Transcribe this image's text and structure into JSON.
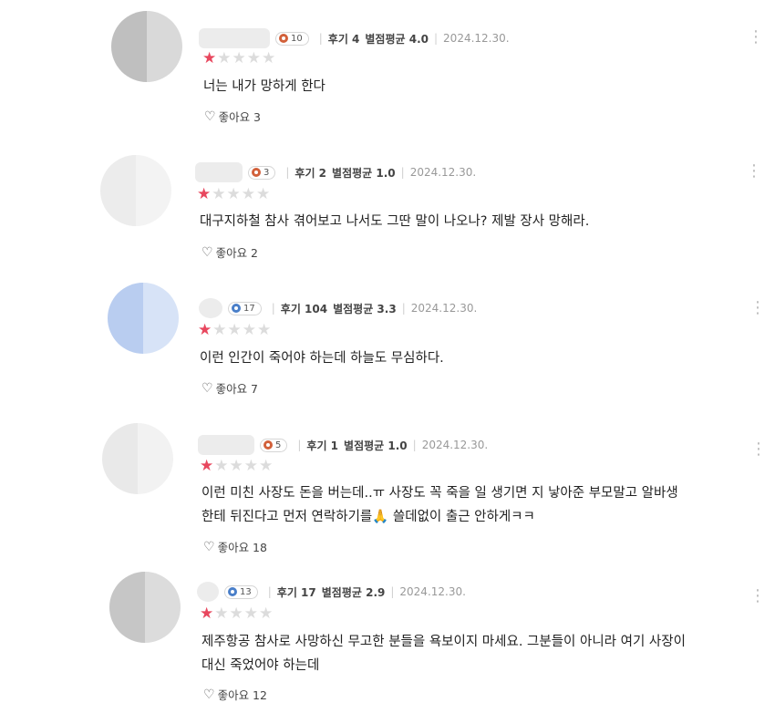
{
  "review_list": [
    {
      "avatar_colors": [
        "#bfbfbf",
        "#d9d9d9"
      ],
      "badge_count": "10",
      "badge_color": "#d2603a",
      "reviews": "후기 4",
      "average": "별점평균 4.0",
      "date": "2024.12.30.",
      "stars": 1,
      "text_lines": [
        "너는 내가 망하게 한다"
      ],
      "like_label": "좋아요 3"
    },
    {
      "avatar_colors": [
        "#ececec",
        "#f3f3f3"
      ],
      "badge_count": "3",
      "badge_color": "#d2603a",
      "reviews": "후기 2",
      "average": "별점평균 1.0",
      "date": "2024.12.30.",
      "stars": 1,
      "text_lines": [
        "대구지하철 참사 겪어보고 나서도 그딴 말이 나오나? 제발 장사 망해라."
      ],
      "like_label": "좋아요 2"
    },
    {
      "avatar_colors": [
        "#b9cdf0",
        "#d7e3f7"
      ],
      "badge_count": "17",
      "badge_color": "#4a7fc9",
      "reviews": "후기 104",
      "average": "별점평균 3.3",
      "date": "2024.12.30.",
      "stars": 1,
      "text_lines": [
        "이런 인간이 죽어야 하는데 하늘도 무심하다."
      ],
      "like_label": "좋아요 7"
    },
    {
      "avatar_colors": [
        "#e9e9e9",
        "#f2f2f2"
      ],
      "badge_count": "5",
      "badge_color": "#d2603a",
      "reviews": "후기 1",
      "average": "별점평균 1.0",
      "date": "2024.12.30.",
      "stars": 1,
      "text_lines": [
        "이런 미친 사장도 돈을 버는데..ㅠ 사장도 꼭 죽을 일 생기면 지 낳아준 부모말고 알바생",
        "한테 뒤진다고 먼저 연락하기를🙏 쓸데없이 출근 안하게ㅋㅋ"
      ],
      "like_label": "좋아요 18"
    },
    {
      "avatar_colors": [
        "#c6c6c6",
        "#dcdcdc"
      ],
      "badge_count": "13",
      "badge_color": "#4a7fc9",
      "reviews": "후기 17",
      "average": "별점평균 2.9",
      "date": "2024.12.30.",
      "stars": 1,
      "text_lines": [
        "제주항공 참사로 사망하신 무고한 분들을 욕보이지 마세요. 그분들이 아니라 여기 사장이",
        "대신 죽었어야 하는데"
      ],
      "like_label": "좋아요 12"
    }
  ],
  "icons": {
    "like": "heart-outline-icon",
    "more": "vertical-dots-icon",
    "star": "star-icon"
  },
  "colors": {
    "star_on": "#e8475e",
    "star_off": "#dcdcdc"
  }
}
